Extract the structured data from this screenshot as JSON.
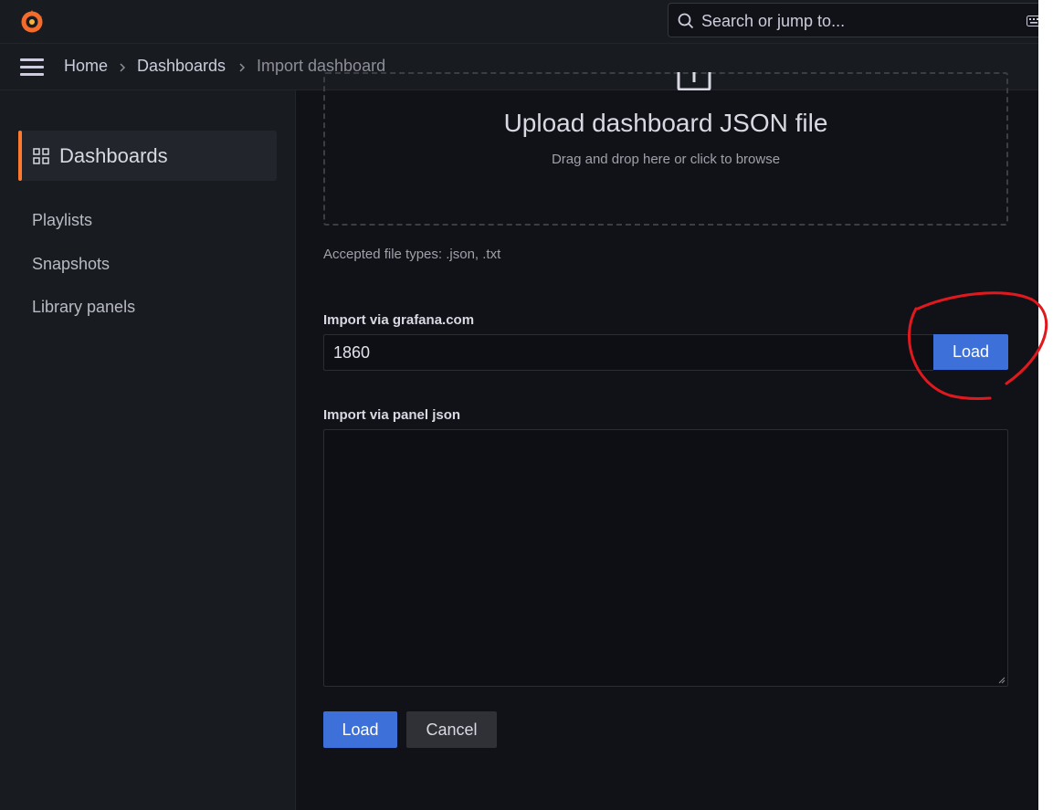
{
  "topbar": {
    "logo_icon": "grafana-logo-icon",
    "search": {
      "placeholder": "Search or jump to...",
      "icon": "search-icon",
      "shortcut_icon": "keyboard-icon"
    }
  },
  "breadcrumb": {
    "menu_icon": "hamburger-menu-icon",
    "items": [
      {
        "label": "Home"
      },
      {
        "label": "Dashboards"
      },
      {
        "label": "Import dashboard"
      }
    ]
  },
  "sidebar": {
    "section": {
      "label": "Dashboards",
      "icon": "apps-grid-icon"
    },
    "items": [
      {
        "label": "Playlists"
      },
      {
        "label": "Snapshots"
      },
      {
        "label": "Library panels"
      }
    ]
  },
  "upload": {
    "icon": "upload-icon",
    "title": "Upload dashboard JSON file",
    "subtitle": "Drag and drop here or click to browse",
    "accepted": "Accepted file types: .json, .txt"
  },
  "grafana_com": {
    "label": "Import via grafana.com",
    "value": "1860",
    "load_label": "Load"
  },
  "panel_json": {
    "label": "Import via panel json",
    "value": ""
  },
  "actions": {
    "load_label": "Load",
    "cancel_label": "Cancel"
  },
  "colors": {
    "accent": "#ff7a2e",
    "primary_button": "#3d71d9",
    "annotation": "#e0191f"
  }
}
